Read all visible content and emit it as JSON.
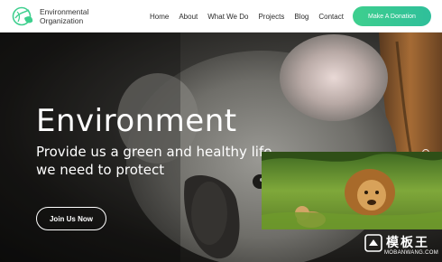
{
  "header": {
    "logo_line1": "Environmental",
    "logo_line2": "Organization",
    "nav": [
      "Home",
      "About",
      "What We Do",
      "Projects",
      "Blog",
      "Contact"
    ],
    "donate_label": "Make A Donation"
  },
  "hero": {
    "title": "Environment",
    "subtitle_line1": "Provide us a green and healthy life",
    "subtitle_line2": "we need to protect",
    "cta_label": "Join Us Now",
    "slides": 3,
    "active_slide": 1
  },
  "watermark": {
    "title": "模板王",
    "sub": "MOBANWANG.COM"
  },
  "colors": {
    "accent": "#3ecf8e",
    "header_bg": "#ffffff",
    "hero_text": "#ffffff"
  },
  "icons": [
    "leaf-globe-logo-icon",
    "watermark-logo-icon"
  ]
}
